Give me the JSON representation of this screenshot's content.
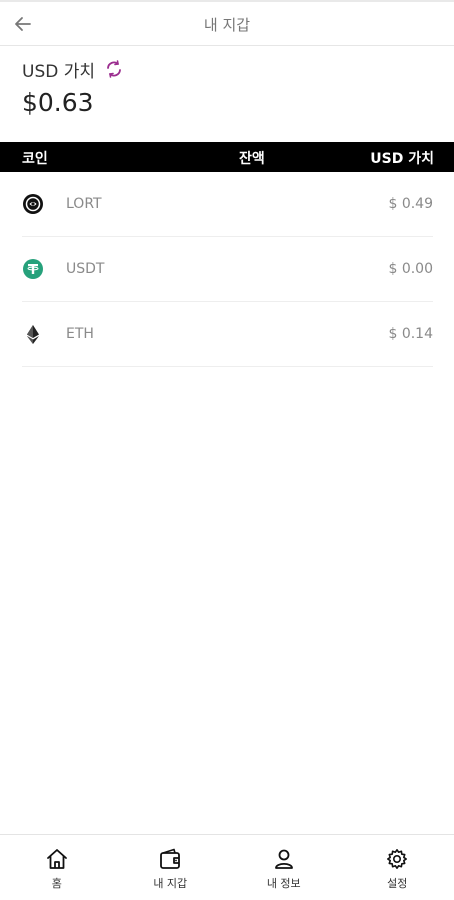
{
  "header": {
    "title": "내 지갑",
    "back_icon": "arrow-left-icon"
  },
  "wallet_value": {
    "label": "USD 가치",
    "amount": "$0.63",
    "refresh_icon": "refresh-icon",
    "refresh_color": "#9b2d8f"
  },
  "table": {
    "headers": {
      "coin": "코인",
      "balance": "잔액",
      "usd_value": "USD 가치"
    },
    "rows": [
      {
        "icon": "lort-coin-icon",
        "name": "LORT",
        "usd": "$ 0.49"
      },
      {
        "icon": "tether-coin-icon",
        "name": "USDT",
        "usd": "$ 0.00"
      },
      {
        "icon": "ethereum-coin-icon",
        "name": "ETH",
        "usd": "$ 0.14"
      }
    ]
  },
  "nav": {
    "items": [
      {
        "icon": "home-icon",
        "label": "홈"
      },
      {
        "icon": "wallet-icon",
        "label": "내 지갑"
      },
      {
        "icon": "user-icon",
        "label": "내 정보"
      },
      {
        "icon": "gear-icon",
        "label": "설정"
      }
    ]
  },
  "colors": {
    "header_bar": "#000000",
    "tether": "#26a17b",
    "muted_text": "#8a8a8a"
  }
}
